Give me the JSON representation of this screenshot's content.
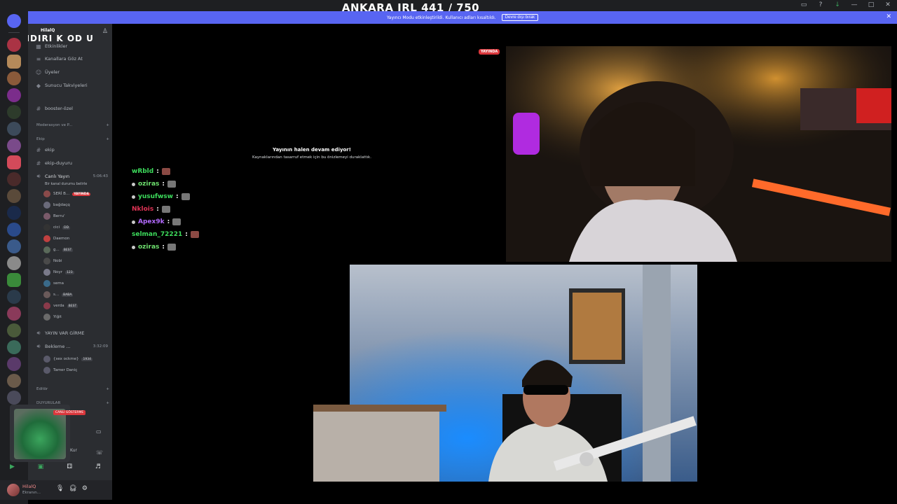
{
  "overlay_title": "ANKARA IRL 441 / 750",
  "notice": {
    "text": "Yayıncı Modu etkinleştirildi. Kullanıcı adları kısaltıldı.",
    "button": "Devre dışı bırak"
  },
  "server": {
    "name": "HilalQ",
    "logo_text": "NDIRI K OD U"
  },
  "sidebar_items": [
    {
      "label": "Etkinlikler",
      "icon": "calendar-icon"
    },
    {
      "label": "Kanallara Göz At",
      "icon": "browse-icon"
    },
    {
      "label": "Üyeler",
      "icon": "members-icon"
    },
    {
      "label": "Sunucu Takviyeleri",
      "icon": "boost-icon"
    }
  ],
  "channels": {
    "booster": "booster-özel",
    "cat_moderasyon": "Moderasyon ve P...",
    "cat_ekip": "Ekip",
    "ekip": "ekip",
    "ekip_duyuru": "ekip-duyuru",
    "voice_live": "Canlı Yayın",
    "voice_live_timer": "5:06:43",
    "voice_live_status": "Bir kanal durumu belirle",
    "cat_yayin": "YAYIN VAR GİRME",
    "voice_wait": "Bekleme ...",
    "voice_wait_timer": "3:32:09",
    "cat_editor": "Editör",
    "cat_duyurular": "DUYURULAR"
  },
  "voice_users": [
    {
      "name": "SERİ B...",
      "tag": "",
      "live": "YAYINDA"
    },
    {
      "name": "bağdaçq",
      "tag": "",
      "live": ""
    },
    {
      "name": "Berru'",
      "tag": "",
      "live": ""
    },
    {
      "name": "cici",
      "tag": "DD",
      "live": ""
    },
    {
      "name": "Daemon",
      "tag": "",
      "live": ""
    },
    {
      "name": "g...",
      "tag": "BEST",
      "live": ""
    },
    {
      "name": "Nobi",
      "tag": "",
      "live": ""
    },
    {
      "name": "Noyr",
      "tag": "123",
      "live": ""
    },
    {
      "name": "sema",
      "tag": "",
      "live": ""
    },
    {
      "name": "s...",
      "tag": "BABA",
      "live": ""
    },
    {
      "name": "verda",
      "tag": "BEST",
      "live": ""
    },
    {
      "name": "Yiğit",
      "tag": "",
      "live": ""
    }
  ],
  "wait_users": [
    {
      "name": "{sex ockme}",
      "tag": "1934"
    },
    {
      "name": "Tamer Daniç",
      "tag": ""
    }
  ],
  "mini_player": {
    "badge": "CANLI GÖSTERME",
    "side": "Kur"
  },
  "user": {
    "name": "HilalQ",
    "status": "Ekranın..."
  },
  "stage": {
    "paused_title": "Yayının halen devam ediyor!",
    "paused_sub": "Kaynaklarından tasarruf etmek için bu önizlemeyi duraklattık.",
    "live_badge": "YAYINDA"
  },
  "chat": [
    {
      "user": "wRbld",
      "color": "#3ddc5c",
      "emote": "red",
      "dot": false
    },
    {
      "user": "oziras",
      "color": "#6ee06e",
      "emote": "gray",
      "dot": true
    },
    {
      "user": "yusufwsw",
      "color": "#3ddc5c",
      "emote": "gray",
      "dot": true
    },
    {
      "user": "Nklois",
      "color": "#e03355",
      "emote": "gray",
      "dot": false
    },
    {
      "user": "Apex9k",
      "color": "#b36bff",
      "emote": "gray",
      "dot": true
    },
    {
      "user": "selman_72221",
      "color": "#3ddc5c",
      "emote": "red",
      "dot": false
    },
    {
      "user": "oziras",
      "color": "#6ee06e",
      "emote": "gray",
      "dot": true
    }
  ]
}
